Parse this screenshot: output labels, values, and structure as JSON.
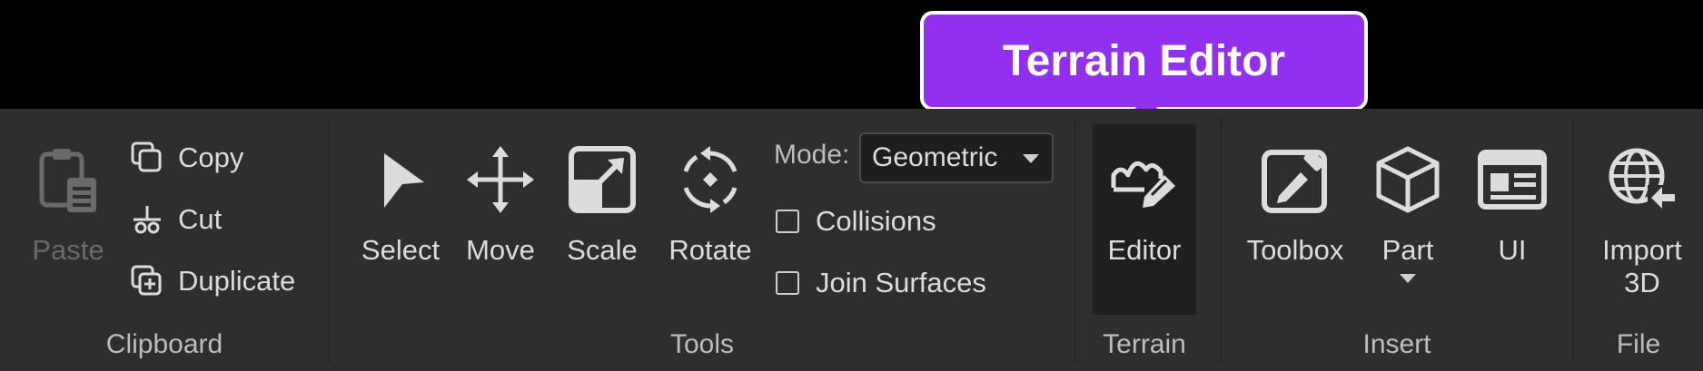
{
  "tooltip": {
    "text": "Terrain Editor"
  },
  "clipboard": {
    "group_label": "Clipboard",
    "paste_label": "Paste",
    "copy_label": "Copy",
    "cut_label": "Cut",
    "duplicate_label": "Duplicate"
  },
  "tools": {
    "group_label": "Tools",
    "select_label": "Select",
    "move_label": "Move",
    "scale_label": "Scale",
    "rotate_label": "Rotate",
    "mode_label": "Mode:",
    "mode_value": "Geometric",
    "collisions_label": "Collisions",
    "join_surfaces_label": "Join Surfaces"
  },
  "terrain": {
    "group_label": "Terrain",
    "editor_label": "Editor"
  },
  "insert": {
    "group_label": "Insert",
    "toolbox_label": "Toolbox",
    "part_label": "Part",
    "ui_label": "UI"
  },
  "file": {
    "group_label": "File",
    "import_label": "Import 3D"
  },
  "colors": {
    "ribbon_bg": "#2e2e2e",
    "tooltip_bg": "#9131ef",
    "text": "#dcdcdc",
    "disabled_text": "#6a6a6a"
  }
}
